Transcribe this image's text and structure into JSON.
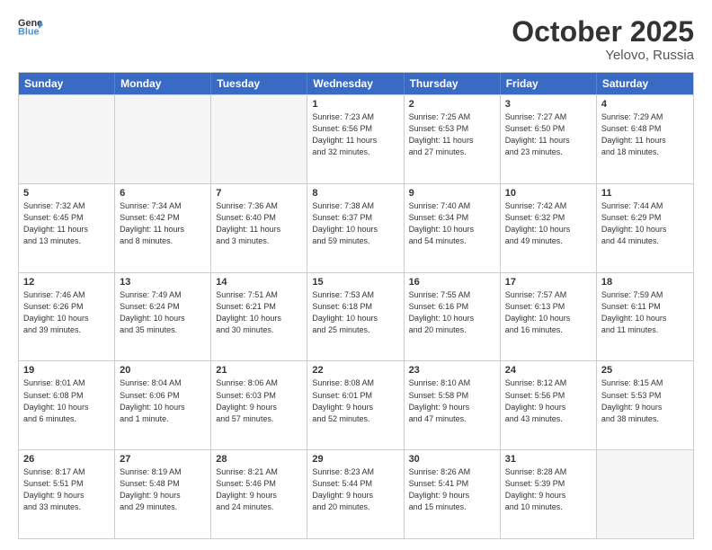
{
  "header": {
    "logo_general": "General",
    "logo_blue": "Blue",
    "month": "October 2025",
    "location": "Yelovo, Russia"
  },
  "days_of_week": [
    "Sunday",
    "Monday",
    "Tuesday",
    "Wednesday",
    "Thursday",
    "Friday",
    "Saturday"
  ],
  "weeks": [
    [
      {
        "day": "",
        "text": "",
        "empty": true
      },
      {
        "day": "",
        "text": "",
        "empty": true
      },
      {
        "day": "",
        "text": "",
        "empty": true
      },
      {
        "day": "1",
        "text": "Sunrise: 7:23 AM\nSunset: 6:56 PM\nDaylight: 11 hours\nand 32 minutes."
      },
      {
        "day": "2",
        "text": "Sunrise: 7:25 AM\nSunset: 6:53 PM\nDaylight: 11 hours\nand 27 minutes."
      },
      {
        "day": "3",
        "text": "Sunrise: 7:27 AM\nSunset: 6:50 PM\nDaylight: 11 hours\nand 23 minutes."
      },
      {
        "day": "4",
        "text": "Sunrise: 7:29 AM\nSunset: 6:48 PM\nDaylight: 11 hours\nand 18 minutes."
      }
    ],
    [
      {
        "day": "5",
        "text": "Sunrise: 7:32 AM\nSunset: 6:45 PM\nDaylight: 11 hours\nand 13 minutes."
      },
      {
        "day": "6",
        "text": "Sunrise: 7:34 AM\nSunset: 6:42 PM\nDaylight: 11 hours\nand 8 minutes."
      },
      {
        "day": "7",
        "text": "Sunrise: 7:36 AM\nSunset: 6:40 PM\nDaylight: 11 hours\nand 3 minutes."
      },
      {
        "day": "8",
        "text": "Sunrise: 7:38 AM\nSunset: 6:37 PM\nDaylight: 10 hours\nand 59 minutes."
      },
      {
        "day": "9",
        "text": "Sunrise: 7:40 AM\nSunset: 6:34 PM\nDaylight: 10 hours\nand 54 minutes."
      },
      {
        "day": "10",
        "text": "Sunrise: 7:42 AM\nSunset: 6:32 PM\nDaylight: 10 hours\nand 49 minutes."
      },
      {
        "day": "11",
        "text": "Sunrise: 7:44 AM\nSunset: 6:29 PM\nDaylight: 10 hours\nand 44 minutes."
      }
    ],
    [
      {
        "day": "12",
        "text": "Sunrise: 7:46 AM\nSunset: 6:26 PM\nDaylight: 10 hours\nand 39 minutes."
      },
      {
        "day": "13",
        "text": "Sunrise: 7:49 AM\nSunset: 6:24 PM\nDaylight: 10 hours\nand 35 minutes."
      },
      {
        "day": "14",
        "text": "Sunrise: 7:51 AM\nSunset: 6:21 PM\nDaylight: 10 hours\nand 30 minutes."
      },
      {
        "day": "15",
        "text": "Sunrise: 7:53 AM\nSunset: 6:18 PM\nDaylight: 10 hours\nand 25 minutes."
      },
      {
        "day": "16",
        "text": "Sunrise: 7:55 AM\nSunset: 6:16 PM\nDaylight: 10 hours\nand 20 minutes."
      },
      {
        "day": "17",
        "text": "Sunrise: 7:57 AM\nSunset: 6:13 PM\nDaylight: 10 hours\nand 16 minutes."
      },
      {
        "day": "18",
        "text": "Sunrise: 7:59 AM\nSunset: 6:11 PM\nDaylight: 10 hours\nand 11 minutes."
      }
    ],
    [
      {
        "day": "19",
        "text": "Sunrise: 8:01 AM\nSunset: 6:08 PM\nDaylight: 10 hours\nand 6 minutes."
      },
      {
        "day": "20",
        "text": "Sunrise: 8:04 AM\nSunset: 6:06 PM\nDaylight: 10 hours\nand 1 minute."
      },
      {
        "day": "21",
        "text": "Sunrise: 8:06 AM\nSunset: 6:03 PM\nDaylight: 9 hours\nand 57 minutes."
      },
      {
        "day": "22",
        "text": "Sunrise: 8:08 AM\nSunset: 6:01 PM\nDaylight: 9 hours\nand 52 minutes."
      },
      {
        "day": "23",
        "text": "Sunrise: 8:10 AM\nSunset: 5:58 PM\nDaylight: 9 hours\nand 47 minutes."
      },
      {
        "day": "24",
        "text": "Sunrise: 8:12 AM\nSunset: 5:56 PM\nDaylight: 9 hours\nand 43 minutes."
      },
      {
        "day": "25",
        "text": "Sunrise: 8:15 AM\nSunset: 5:53 PM\nDaylight: 9 hours\nand 38 minutes."
      }
    ],
    [
      {
        "day": "26",
        "text": "Sunrise: 8:17 AM\nSunset: 5:51 PM\nDaylight: 9 hours\nand 33 minutes."
      },
      {
        "day": "27",
        "text": "Sunrise: 8:19 AM\nSunset: 5:48 PM\nDaylight: 9 hours\nand 29 minutes."
      },
      {
        "day": "28",
        "text": "Sunrise: 8:21 AM\nSunset: 5:46 PM\nDaylight: 9 hours\nand 24 minutes."
      },
      {
        "day": "29",
        "text": "Sunrise: 8:23 AM\nSunset: 5:44 PM\nDaylight: 9 hours\nand 20 minutes."
      },
      {
        "day": "30",
        "text": "Sunrise: 8:26 AM\nSunset: 5:41 PM\nDaylight: 9 hours\nand 15 minutes."
      },
      {
        "day": "31",
        "text": "Sunrise: 8:28 AM\nSunset: 5:39 PM\nDaylight: 9 hours\nand 10 minutes."
      },
      {
        "day": "",
        "text": "",
        "empty": true
      }
    ]
  ]
}
